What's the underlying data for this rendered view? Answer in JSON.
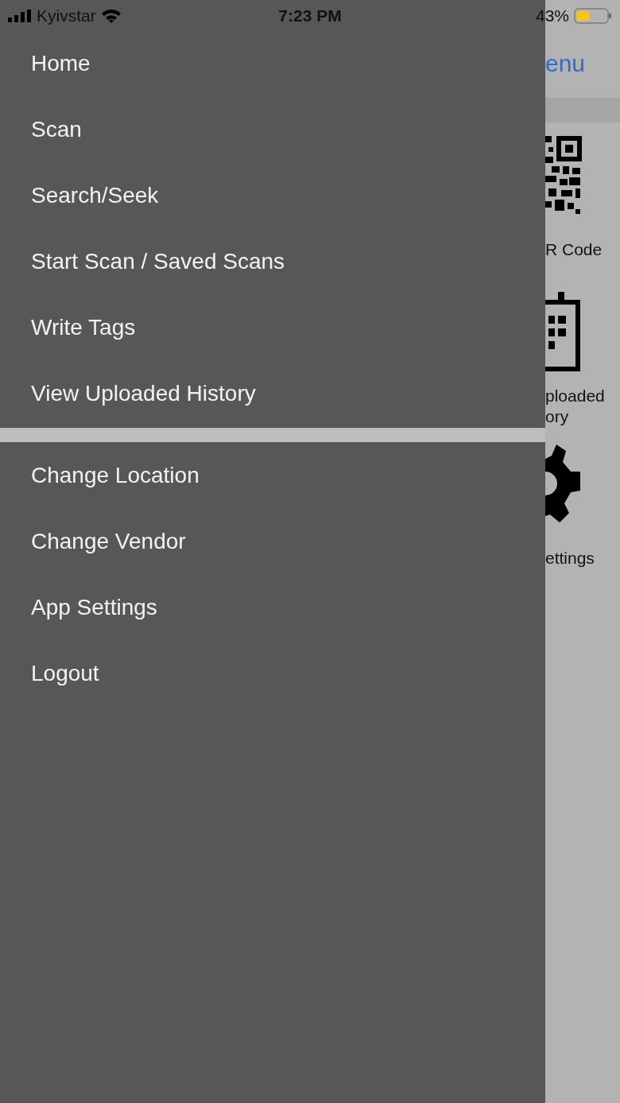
{
  "status_bar": {
    "carrier": "Kyivstar",
    "time": "7:23 PM",
    "battery": "43%"
  },
  "drawer": {
    "groups": [
      {
        "items": [
          {
            "label": "Home"
          },
          {
            "label": "Scan"
          },
          {
            "label": "Search/Seek"
          },
          {
            "label": "Start Scan / Saved Scans"
          },
          {
            "label": "Write Tags"
          },
          {
            "label": "View Uploaded History"
          }
        ]
      },
      {
        "items": [
          {
            "label": "Change Location"
          },
          {
            "label": "Change Vendor"
          },
          {
            "label": "App Settings"
          },
          {
            "label": "Logout"
          }
        ]
      }
    ]
  },
  "background_screen": {
    "nav_button": "enu",
    "tiles": [
      {
        "kind": "qr",
        "label_lines": [
          "R Code"
        ]
      },
      {
        "kind": "clipboard",
        "label_lines": [
          "ploaded",
          "ory"
        ]
      },
      {
        "kind": "gear",
        "label_lines": [
          "ettings"
        ]
      }
    ]
  }
}
